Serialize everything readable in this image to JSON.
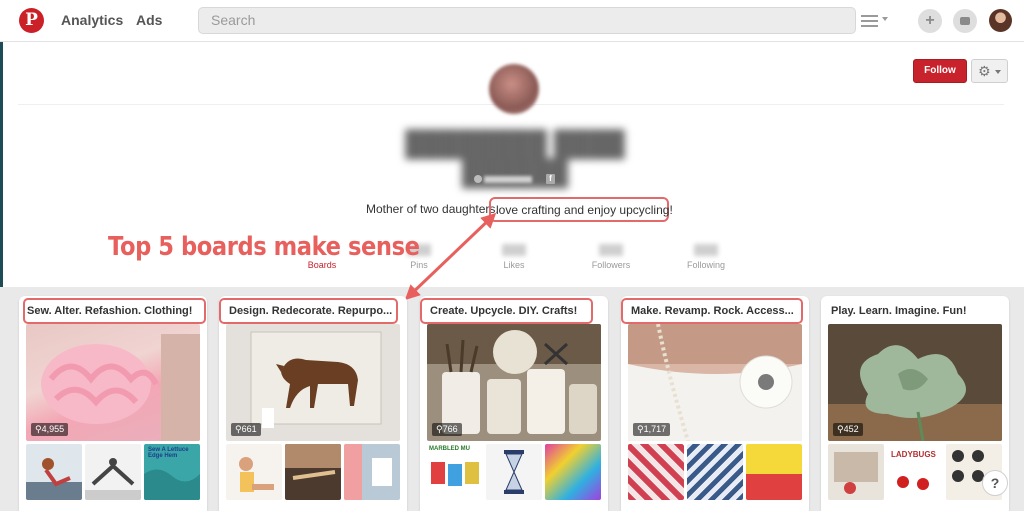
{
  "topbar": {
    "logo": "P",
    "nav": [
      "Analytics",
      "Ads"
    ],
    "search_placeholder": "Search",
    "add_label": "+"
  },
  "profile": {
    "follow_label": "Follow",
    "bio": "Mother of two daughters.",
    "bio_highlight": "love crafting and enjoy upcycling!",
    "stats": [
      {
        "label": "Boards",
        "active": true
      },
      {
        "label": "Pins"
      },
      {
        "label": "Likes"
      },
      {
        "label": "Followers"
      },
      {
        "label": "Following"
      }
    ]
  },
  "annotation": "Top 5 boards make sense",
  "boards": [
    {
      "title": "Sew. Alter. Refashion. Clothing!",
      "pins": "4,955",
      "thumb_text": "Sew A Lettuce Edge Hem"
    },
    {
      "title": "Design. Redecorate. Repurpo...",
      "pins": "661"
    },
    {
      "title": "Create. Upcycle. DIY. Crafts!",
      "pins": "766",
      "thumb_text": "MARBLED MU"
    },
    {
      "title": "Make. Revamp. Rock. Access...",
      "pins": "1,717"
    },
    {
      "title": "Play. Learn. Imagine. Fun!",
      "pins": "452",
      "thumb_text": "LADYBUGS"
    }
  ],
  "help": "?",
  "colors": {
    "brand": "#cb2027",
    "annotation": "#e8605d"
  }
}
